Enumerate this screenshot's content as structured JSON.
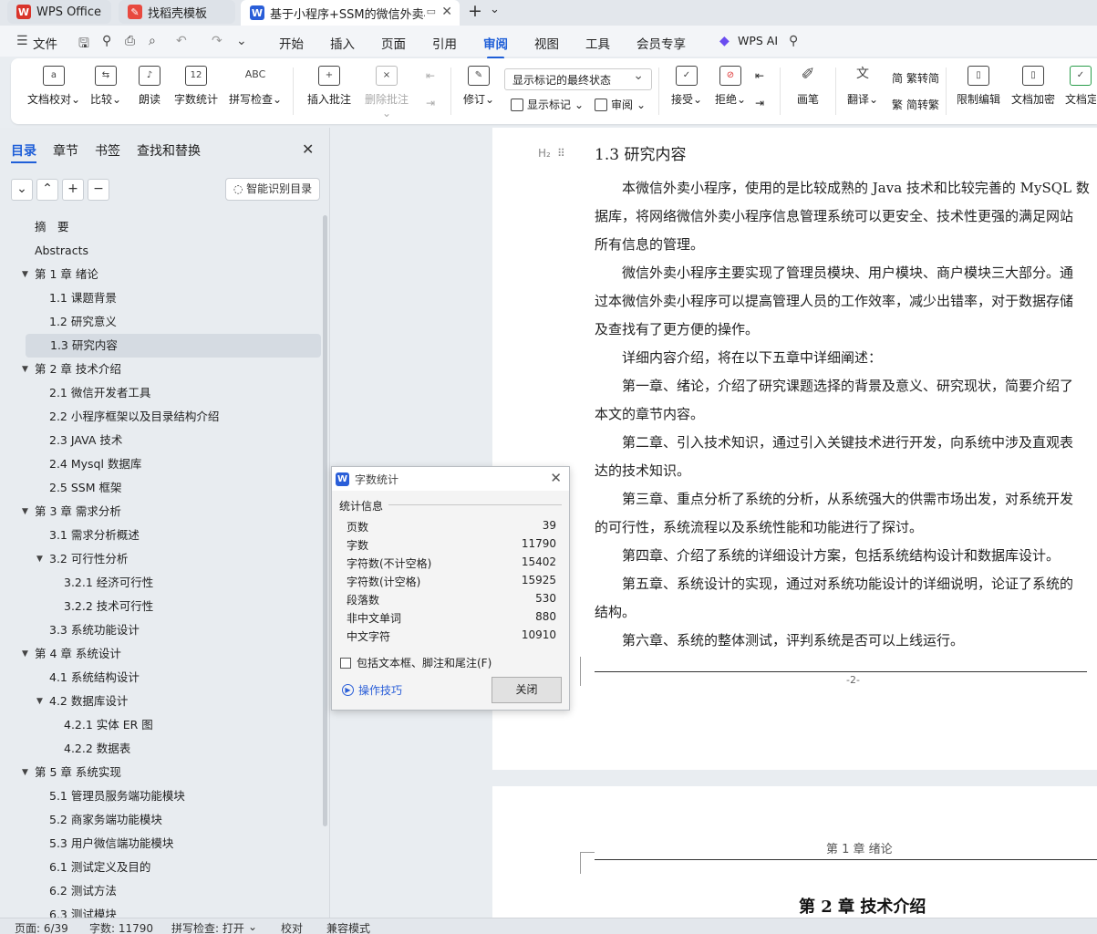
{
  "titlebar": {
    "tabs": [
      {
        "label": "WPS Office",
        "icon": "wps-logo-icon",
        "color": "#d9342b"
      },
      {
        "label": "找稻壳模板",
        "icon": "docer-icon",
        "color": "#e8493f"
      },
      {
        "label": "基于小程序+SSM的微信外卖小",
        "icon": "word-doc-icon",
        "color": "#2a5ed8"
      }
    ],
    "new_tab": "+",
    "tab_list": "⌄"
  },
  "menu": {
    "file": "文件",
    "items": [
      "开始",
      "插入",
      "页面",
      "引用",
      "审阅",
      "视图",
      "工具",
      "会员专享"
    ],
    "active": "审阅",
    "wps_ai": "WPS AI",
    "accent": "#1f5fd8"
  },
  "ribbon": {
    "buttons": [
      {
        "label": "文档校对",
        "glyph": "a"
      },
      {
        "label": "比较",
        "glyph": "⇆"
      },
      {
        "label": "朗读",
        "glyph": "♪"
      },
      {
        "label": "字数统计",
        "glyph": "12"
      },
      {
        "label": "拼写检查",
        "glyph": "ABC"
      },
      {
        "label": "插入批注",
        "glyph": "+"
      },
      {
        "label": "删除批注",
        "glyph": "×"
      },
      {
        "label": "修订",
        "glyph": "✎"
      },
      {
        "label": "接受",
        "glyph": "✓"
      },
      {
        "label": "拒绝",
        "glyph": "⊘"
      },
      {
        "label": "画笔",
        "glyph": "✐"
      },
      {
        "label": "翻译",
        "glyph": "文"
      },
      {
        "label": "限制编辑",
        "glyph": "🔒"
      },
      {
        "label": "文档加密",
        "glyph": "🔒"
      },
      {
        "label": "文档定"
      }
    ],
    "markup_select": "显示标记的最终状态",
    "show_markup": "显示标记",
    "review": "审阅",
    "trad": "繁转简",
    "simp": "简转繁"
  },
  "nav": {
    "tabs": [
      "目录",
      "章节",
      "书签",
      "查找和替换"
    ],
    "ai_toc": "智能识别目录",
    "toc": [
      {
        "label": "摘　要",
        "level": 0,
        "caret": false
      },
      {
        "label": "Abstracts",
        "level": 0,
        "caret": false
      },
      {
        "label": "第 1 章  绪论",
        "level": 0,
        "caret": true
      },
      {
        "label": "1.1 课题背景",
        "level": 1,
        "caret": false
      },
      {
        "label": "1.2 研究意义",
        "level": 1,
        "caret": false
      },
      {
        "label": "1.3 研究内容",
        "level": 1,
        "caret": false,
        "selected": true
      },
      {
        "label": "第 2 章  技术介绍",
        "level": 0,
        "caret": true
      },
      {
        "label": "2.1 微信开发者工具",
        "level": 1,
        "caret": false
      },
      {
        "label": "2.2 小程序框架以及目录结构介绍",
        "level": 1,
        "caret": false
      },
      {
        "label": "2.3 JAVA 技术",
        "level": 1,
        "caret": false
      },
      {
        "label": "2.4    Mysql 数据库",
        "level": 1,
        "caret": false
      },
      {
        "label": "2.5 SSM 框架",
        "level": 1,
        "caret": false
      },
      {
        "label": "第 3 章  需求分析",
        "level": 0,
        "caret": true
      },
      {
        "label": "3.1 需求分析概述",
        "level": 1,
        "caret": false
      },
      {
        "label": "3.2 可行性分析",
        "level": 1,
        "caret": true
      },
      {
        "label": "3.2.1 经济可行性",
        "level": 2,
        "caret": false
      },
      {
        "label": "3.2.2 技术可行性",
        "level": 2,
        "caret": false
      },
      {
        "label": "3.3 系统功能设计",
        "level": 1,
        "caret": false
      },
      {
        "label": "第 4 章  系统设计",
        "level": 0,
        "caret": true
      },
      {
        "label": "4.1 系统结构设计",
        "level": 1,
        "caret": false
      },
      {
        "label": "4.2 数据库设计",
        "level": 1,
        "caret": true
      },
      {
        "label": "4.2.1 实体 ER 图",
        "level": 2,
        "caret": false
      },
      {
        "label": "4.2.2 数据表",
        "level": 2,
        "caret": false
      },
      {
        "label": "第 5 章  系统实现",
        "level": 0,
        "caret": true
      },
      {
        "label": "5.1 管理员服务端功能模块",
        "level": 1,
        "caret": false
      },
      {
        "label": "5.2 商家务端功能模块",
        "level": 1,
        "caret": false
      },
      {
        "label": "5.3 用户微信端功能模块",
        "level": 1,
        "caret": false
      },
      {
        "label": "6.1 测试定义及目的",
        "level": 1,
        "caret": false
      },
      {
        "label": "6.2 测试方法",
        "level": 1,
        "caret": false
      },
      {
        "label": "6.3 测试模块",
        "level": 1,
        "caret": false
      }
    ]
  },
  "document": {
    "heading_tag": "H₂",
    "heading": "1.3 研究内容",
    "lines": [
      "　　本微信外卖小程序，使用的是比较成熟的 Java 技术和比较完善的 MySQL 数",
      "据库，将网络微信外卖小程序信息管理系统可以更安全、技术性更强的满足网站",
      "所有信息的管理。",
      "　　微信外卖小程序主要实现了管理员模块、用户模块、商户模块三大部分。通",
      "过本微信外卖小程序可以提高管理人员的工作效率，减少出错率，对于数据存储",
      "及查找有了更方便的操作。",
      "　　详细内容介绍，将在以下五章中详细阐述：",
      "　　第一章、绪论，介绍了研究课题选择的背景及意义、研究现状，简要介绍了",
      "本文的章节内容。",
      "　　第二章、引入技术知识，通过引入关键技术进行开发，向系统中涉及直观表",
      "达的技术知识。",
      "　　第三章、重点分析了系统的分析，从系统强大的供需市场出发，对系统开发",
      "的可行性，系统流程以及系统性能和功能进行了探讨。",
      "　　第四章、介绍了系统的详细设计方案，包括系统结构设计和数据库设计。",
      "　　第五章、系统设计的实现，通过对系统功能设计的详细说明，论证了系统的",
      "结构。",
      "　　第六章、系统的整体测试，评判系统是否可以上线运行。"
    ],
    "page_number": "-2-",
    "page2_header": "第 1 章  绪论",
    "page2_heading": "第 2 章  技术介绍"
  },
  "dialog": {
    "title": "字数统计",
    "section": "统计信息",
    "stats": [
      {
        "label": "页数",
        "value": "39"
      },
      {
        "label": "字数",
        "value": "11790"
      },
      {
        "label": "字符数(不计空格)",
        "value": "15402"
      },
      {
        "label": "字符数(计空格)",
        "value": "15925"
      },
      {
        "label": "段落数",
        "value": "530"
      },
      {
        "label": "非中文单词",
        "value": "880"
      },
      {
        "label": "中文字符",
        "value": "10910"
      }
    ],
    "checkbox": "包括文本框、脚注和尾注(F)",
    "tips": "操作技巧",
    "close": "关闭"
  },
  "status": {
    "page": "页面: 6/39",
    "words": "字数: 11790",
    "spell": "拼写检查: 打开",
    "proof": "校对",
    "compat": "兼容模式"
  }
}
